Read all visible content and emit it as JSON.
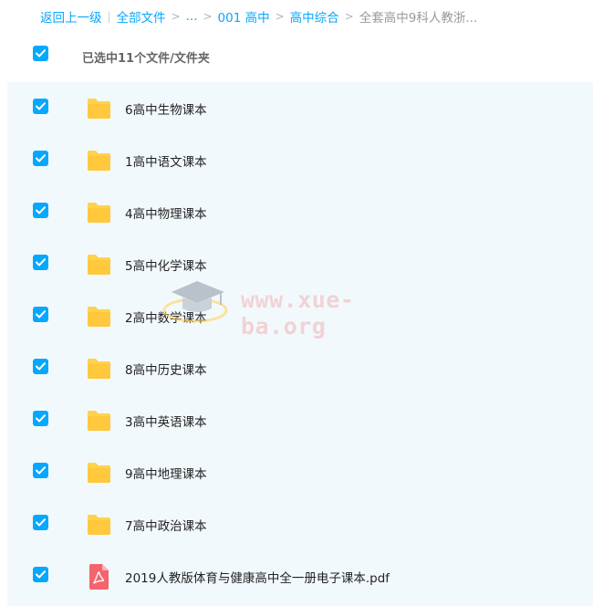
{
  "breadcrumb": {
    "back_label": "返回上一级",
    "items": [
      "全部文件",
      "...",
      "001 高中",
      "高中综合"
    ],
    "current": "全套高中9科人教浙..."
  },
  "selection": {
    "summary": "已选中11个文件/文件夹",
    "checked": true
  },
  "files": [
    {
      "name": "6高中生物课本",
      "type": "folder",
      "checked": true
    },
    {
      "name": "1高中语文课本",
      "type": "folder",
      "checked": true
    },
    {
      "name": "4高中物理课本",
      "type": "folder",
      "checked": true
    },
    {
      "name": "5高中化学课本",
      "type": "folder",
      "checked": true
    },
    {
      "name": "2高中数学课本",
      "type": "folder",
      "checked": true
    },
    {
      "name": "8高中历史课本",
      "type": "folder",
      "checked": true
    },
    {
      "name": "3高中英语课本",
      "type": "folder",
      "checked": true
    },
    {
      "name": "9高中地理课本",
      "type": "folder",
      "checked": true
    },
    {
      "name": "7高中政治课本",
      "type": "folder",
      "checked": true
    },
    {
      "name": "2019人教版体育与健康高中全一册电子课本.pdf",
      "type": "pdf",
      "checked": true
    }
  ],
  "watermark": {
    "text": "www.xue-ba.org"
  },
  "colors": {
    "accent": "#06a7ff",
    "folder": "#ffd24e",
    "pdf": "#f5636d",
    "list_background": "#f2f9fd"
  }
}
